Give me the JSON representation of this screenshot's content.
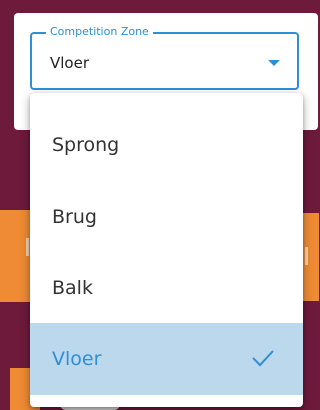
{
  "select": {
    "label": "Competition Zone",
    "value": "Vloer"
  },
  "menu": {
    "items": [
      {
        "label": "Sprong",
        "selected": false
      },
      {
        "label": "Brug",
        "selected": false
      },
      {
        "label": "Balk",
        "selected": false
      },
      {
        "label": "Vloer",
        "selected": true
      }
    ]
  },
  "colors": {
    "background": "#6e1a3b",
    "accent": "#2d8fd5",
    "selected_bg": "#bcd8ec",
    "orange": "#ef8b34"
  },
  "icons": {
    "dropdown": "chevron-down-icon",
    "selected": "check-icon"
  }
}
